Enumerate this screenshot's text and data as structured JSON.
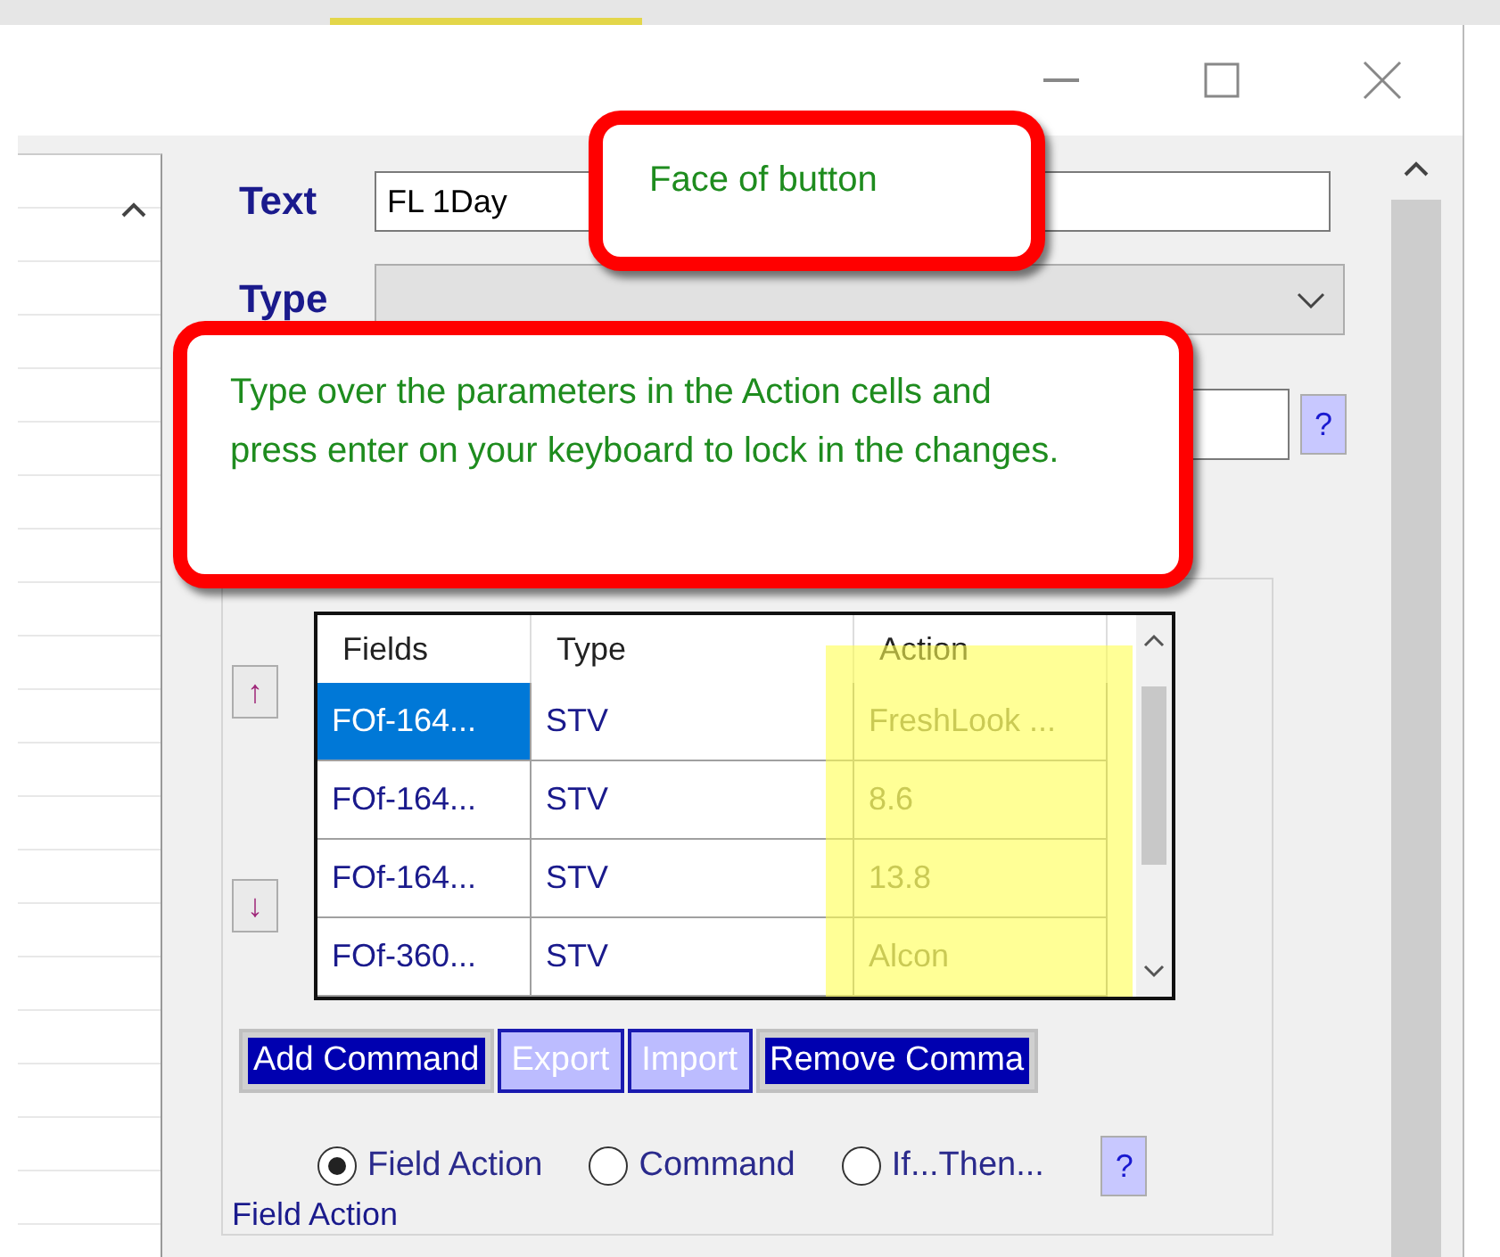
{
  "form": {
    "text_label": "Text",
    "text_value": "FL 1Day",
    "type_label": "Type",
    "help_button": "?"
  },
  "table": {
    "columns": [
      "Fields",
      "Type",
      "Action"
    ],
    "rows": [
      {
        "cells": [
          "FOf-164...",
          "STV",
          "FreshLook ..."
        ],
        "selected": true
      },
      {
        "cells": [
          "FOf-164...",
          "STV",
          "8.6"
        ],
        "selected": false
      },
      {
        "cells": [
          "FOf-164...",
          "STV",
          "13.8"
        ],
        "selected": false
      },
      {
        "cells": [
          "FOf-360...",
          "STV",
          "Alcon"
        ],
        "selected": false
      }
    ],
    "up_button": "↑",
    "down_button": "↓"
  },
  "buttons": [
    {
      "label": "Add Command",
      "disabled": false
    },
    {
      "label": "Export",
      "disabled": true
    },
    {
      "label": "Import",
      "disabled": true
    },
    {
      "label": "Remove Comma",
      "disabled": false
    }
  ],
  "radios": [
    {
      "label": "Field Action",
      "selected": true
    },
    {
      "label": "Command",
      "selected": false
    },
    {
      "label": "If...Then...",
      "selected": false
    }
  ],
  "radio_help": "?",
  "group_title": "Field Action",
  "callouts": [
    {
      "text": "Face of button"
    },
    {
      "text": "Type over the parameters in the Action cells and press enter on your keyboard to lock in the changes."
    }
  ]
}
